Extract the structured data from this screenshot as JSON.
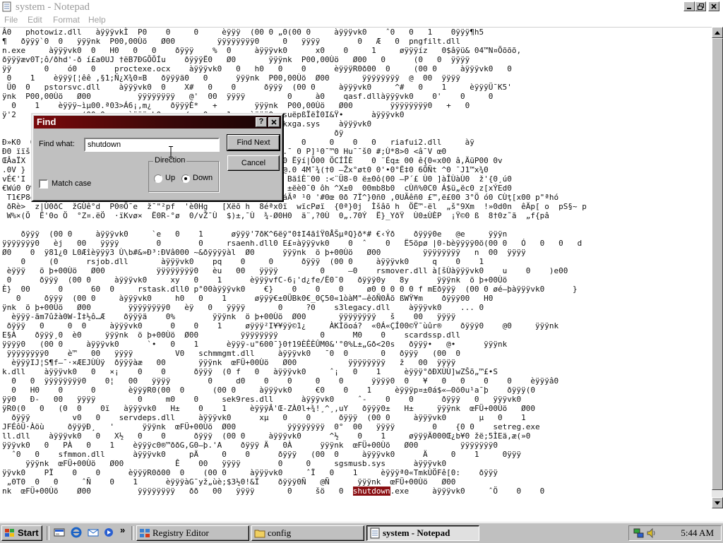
{
  "window": {
    "title": "system - Notepad",
    "menu": [
      "File",
      "Edit",
      "Format",
      "Help"
    ]
  },
  "editor": {
    "lines": [
      "Â0   photowiz.dll   àÿÿÿvkÌ  P0    0     0     èÿÿÿ  (00 0 „0(00 0     àÿÿÿvk0    ˆ0   0   1    0ÿÿÿ¶h5",
      "¶   ðÿÿÿ`0  0   ÿÿÿnk  P00,00Ùö   Ø00         ÿÿÿÿÿÿÿÿ0     0   ÿÿÿÿ        0   Æ   0  pngfilt.dll",
      "n.exe     àÿÿÿvk0  0   H0   0   0    ðÿÿÿ    %  0     àÿÿÿvk0      x0    0     1     øÿÿÿíz   0$âÿü& 04™N¤Õõõõ,",
      "ðÿÿÿæv0T;ô/ðhd'-ð í£a0UJ †ëB7ÐGÕÕÍu    ðÿÿÿË0   Ø0       ÿÿÿnk  P00,00Ùö   Ø00   0      (0   0  ÿÿÿÿ",
      "ÿÿ       0    ó0   0    proctexe.ocx    àÿÿÿvk0   0   h0   0    0      èÿÿÿR0ð00  0     (00 0     àÿÿÿvk0   0",
      " 0    1    èÿÿÿ[¦êê ,§1;Ñ¿X¾0¤B   ðÿÿÿä0   0      ÿÿÿnk  P00,00Ùö  Ø00       ÿÿÿÿÿÿÿÿ  @  00  ÿÿÿÿ",
      " Ü0  0   pstorsvc.dll    àÿÿÿvk0  0    X#   0    0      ðÿÿÿ  (00 0     àÿÿÿvk0     ^#   0    1     èÿÿÿÜ¯K5'",
      "ÿnk  P00,00Ùö   Ø00          ÿÿÿÿÿÿÿÿ   @'  00  ÿÿÿÿ         0     à0    qasf.dllàÿÿÿvk0    0'    0     0",
      "  0    1    èÿÿÿ~ìµ00.ª03>Á6¡,m¿    ðÿÿÿÈ*   +        ÿÿÿnk  P00,00Ùö   Ø00        ÿÿÿÿÿÿÿÿ0   +   0",
      "ÿ'2              (00 0     àÿÿÿvk0    x/   0    1    èÿÿÿ0•„suëpßÏëÌ0I&Ÿ•      àÿÿÿvk0",
      "        0                 03   ÿÿÿÿ           0         r2mdkxga.sys    àÿÿÿvk0",
      "        Kv§l'-Ê0ÊÂ     ðÿÿÿ6  (7       ÿÿÿnk  P00,00Ùö   Ø00           ðÿ",
      "Ð»K0  0  0                       ÿÿÿÿÿÿÿÿ0   >   00  ÿÿÿÿ       0     0    0   0   riafui2.dll     àÿ",
      "Ð0 ïïš                           ¬Ãşn0-0 Ù&ÏÂõ-0 #¾Ab0-0 ÿYÖ.¯ 0 P]¹0¯™0 Hu¯¯š0 #;Ù*8>0 <â¯V œ0",
      "ŒÂaÏX                           ^&°00 0¦`&´00 -0Ü0800 /0.g000 Ëÿí|Õ00 ÖCÍÎÈ    0 ¨Éq± 00 ê{0«x00 â,ÄüP00 0v",
      ".0V }                           x,0 Ï¾²n±0 P¤=0 A=-3h„0 ¨uüí@.0 4M¯¾(†0 –Žx°øt0 0'•0°Ë‡0 6ÕÑt ^0 ¯J1™x¾0",
      "vÉ€'I                          0Ð0Ò Ž00V ô0 2†£]¯õ0 ..2$ÿp00 BãîÈ¨00 :<¨Ü8-0 ë±0ô(00 –P´£ Ù0 ]àÎÙàÙ0  ž'{0¸ú0",
      "€Wú0 0%    ¢0                  +~°&0K0¯Š0 Ð|0 éÜÿª0 ž0-w¯¬_0 ±ëè0¯0 ôh ^X±0  00mb8b0  cÙñ%0C0 Á$ü„ëc0 z[xÝEd0",
      " T1€P8ë0 s0âõ0ê0 ½éÐšèè0 kŽÏwÄë0 »ë0>¨ï0 â   'fpì0 &Â(âH¹0 ÏáÃª ¹0 '#0œ 0ð 7Ï^}0ñ0 ,0UÃêñ0 £™,ë£00 3°Ö ó0 CÙţ[x00 p\"ªhó",
      " ðRè>  z|Ù0ðC  žGÙê°d  P0®Ö¯e  ž¯\"²pf  'è0Hg   [Xëõ h  8éªx0ï  wïcPøï  {0ª}0j  Ìšâõ h  ÖË™-ël  „š\"9Xm  !»0d0n  êÄp[ o  pS§~ p",
      " W%×(Ö  Ë'0o Ö  °Z¤.ëÖ  ·ïKvø×  Ë0R-°ø  0/vŽ¯Ù  $)±,¯Ù  ¾-Ø0H0  ä¨,?0Ù  0„.70Ý  Ë}_YðŸ  Ù0±ÙÈP  ¡Ÿ©0 ß  8†0z˜ã  „f{pâ",
      "",
      "    ðÿÿÿ  (00 0     àÿÿÿvk0     `e   0    1      øÿÿÿ'7ðK^6ëÿ\"0‡I4ãîŸ0ÅŠµªQ}ð*# €‹Ýð    ðÿÿÿ0e   @e     ÿÿÿn",
      "ÿÿÿÿÿÿÿ0   èj   00   ÿÿÿÿ        0        0     rsaenh.dll0 E£¤àÿÿÿvk0    0  ˆ    0   Ë5öpø |0-bèÿÿÿÿ0ö(00 0   Ó   0   0   d",
      "Ø0    0  ÿ81¿0 L0Æîèÿÿÿ3 Ù\\b#&»Ð³:ÐVâ000 ~&ðÿÿÿÿàl  Ø0      ÿÿÿnk  ö þ+00Ùö   Ø00         ÿÿÿÿÿÿÿÿ   n  00  ÿÿÿÿ",
      "    0     (0      rsjob.dll       àÿÿÿvk0    pq    0     0      ðÿÿÿ  (00 0     àÿÿÿvk0     q    0    1",
      " èÿÿÿ   ö þ+00Ùö   Ø00           ÿÿÿÿÿÿÿÿ0   èu   00   ÿÿÿÿ         0     –0    rsmover.dll à[šÙàÿÿÿvk0    u    0    )e00",
      " 0      ðÿÿÿ  (00 0     àÿÿÿvk0     xy   0    1      èÿÿÿvfC-6¡'d¿fe/Ë0¯0   ðÿÿÿ0y   8y      ÿÿÿnk  ö þ+00Ùö  ",
      "È}  00      0      60  0     rstask.dll0 p°00àÿÿÿvk0    €}    0    0    0     ø0 0 0 0 0 f mEðÿÿÿ  (00 0 øé–þàÿÿÿvk0      }",
      "   0     ðÿÿÿ  (00 0     àÿÿÿvk0     h0   0    1      øÿÿÿ€±0ÜBk0€_0Ç50«1òàM\"–êõÑ0Âõ ßWŸ¥m    ðÿÿÿ00   H0",
      "ÿnk  ö þ+00Ùö   Ø00        ÿÿÿÿÿÿÿÿ0   èÿ   0   ÿÿÿÿ       0     ?0    s3legacy.dll    àÿÿÿvk0    ... 0",
      "  èÿÿÿ-ãm7ûžà0W-Ì‡½ô…Æ    ðÿÿÿä    0%        ÿÿÿnk  ö þ+00Ùö  Ø00       ÿÿÿÿÿÿÿÿ   š    00   ÿÿÿÿ",
      " ðÿÿÿ   0     0  0     àÿÿÿvk0      0    0    1     øÿÿÿ²I¥¥ÿÿ©1¿     ÀKÌöoá?  «0Á«ÇÍ00©Ÿ¯ùûr®    ðÿÿÿ0    @0     ÿÿÿnk",
      "E§À    ðÿÿÿ¸0  è0     ÿÿÿnk  ö þ+00Ùö  Ø00         ÿÿÿÿÿÿÿÿ         0      M0    0    scardssp.dll",
      "ÿÿÿÿ0   (00 0     àÿÿÿvk0      `•   0    1      èÿÿÿ-u\"600¯}0†19ÈÊÈÛM0&'°0%L±„Gð<20s   ðÿÿÿ•   @•      ÿÿÿnk",
      " ÿÿÿÿÿÿÿÿ0    è™   00   ÿÿÿÿ         V0   schmmgmt.dll     àÿÿÿvk0   ¯0  0       0   ðÿÿÿ   (00  0",
      "  èÿÿÿIJ¦S¶f–¯·×ÆEJÙÙÿ  ðÿÿÿàæ   00       ÿÿÿnk  œFÜ+00Ùö   Ø00           ÿÿÿÿÿÿÿÿ   ž   00  ÿÿÿÿ",
      "k.dll    àÿÿÿvk0   0   ×¡    0    0      ðÿÿÿ  (0 f   0   àÿÿÿvk0     ˆ¡   0    1     èÿÿÿ°ðÐXÙÙ]wZŠõ„™£•S",
      "  0   0  ÿÿÿÿÿÿÿÿ0    0¦   00   ÿÿÿÿ        0     d0    0    0     0    0      ÿÿÿÿ0  0   ¥   0   0    0    0    èÿÿÿâ0",
      "  0   H0    0      0       èÿÿÿR0(00  0      (00 0     àÿÿÿvk0     €0    0    1     èÿÿÿp¤±0á$«–0ö0u¹a¯þ    ðÿÿÿ(0",
      "ÿÿ0   Ð-   00   ÿÿÿÿ         0     m0    0     sek9res.dll      àÿÿÿvk0     ˆ-    0    0      ðÿÿÿ   0   ÿÿÿvk0",
      "ÿR0(0   0   (0  0    0ï   àÿÿÿvk0   H±    0    1     èÿÿÿÂ'Œ-ZÀ0l+¾!¸^¸,uY   ðÿÿÿ0±   H±     ÿÿÿnk  œFÜ+00Ùö   Ø00",
      "  ðÿÿÿ         v0   0    servdeps.dll     àÿÿÿvk0      xµ   0    0      ðÿÿÿ  (00 0     àÿÿÿvk0       µ   0    1",
      "JFÉôÜ·Àöù     ðÿÿÿÐ¸   '      ÿÿÿnk  œFÜ+00Ùö  Ø00           ÿÿÿÿÿÿÿÿ  0°  00   ÿÿÿÿ        0    {0 0    setreg.exe",
      "ll.dll    àÿÿÿvk0   0   X½   0    0      ðÿÿÿ  (00 0     àÿÿÿvk0      ^½    0    1     øÿÿÿÄ000Œ¿b¥0 žë;5ÌEä,æ(»0",
      "ÿÿÿvk0   0   PÀ   0    1    èÿÿÿc0®™ððG,G0–þ.'A    ðÿÿÿ Ä   0À      ÿÿÿnk  œFÜ+00Ùö   Ø00         ÿÿÿÿÿÿÿ0",
      "  ˆ0   0    sfmmon.dll      àÿÿÿvk0     pÄ     0    0      ðÿÿÿ   (00  0     àÿÿÿvk0      Ä     0    1     0ÿÿÿ",
      "     ÿÿÿnk  œFÜ+00Ùö   Ø00           Ê    00   ÿÿÿÿ        0     0     sgsmusb.sys      àÿÿÿvk0",
      "ÿÿvk0    PÏ    0    0      èÿÿÿR0ð00  0    (00 0     àÿÿÿvk0     ˆÏ   0    1     èÿÿÿª0«TmkÙÖFê[0:    ðÿÿÿ",
      " „0T0  0   0     ˆÑ    0    1      èÿÿÿàG¯yž„ùè;$3½0!&Ï    ðÿÿÿ0Ñ   @Ñ      ÿÿÿnk  œFÜ+00Ùö   Ø00",
      {
        "pre": "nk  œFÜ+00Ùö    Ø00          ÿÿÿÿÿÿÿÿ   ðð   00   ÿÿÿÿ       0     šö   0  ",
        "hl": "shutdown",
        "post": ".exe     àÿÿÿvk0     ˆÖ    0    0"
      }
    ]
  },
  "find_dialog": {
    "title": "Find",
    "find_what_label": "Find what:",
    "find_what_value": "shutdown",
    "find_next_label": "Find Next",
    "cancel_label": "Cancel",
    "direction_label": "Direction",
    "up_label": "Up",
    "down_label": "Down",
    "direction_selected": "Down",
    "match_case_label": "Match case",
    "match_case_checked": false
  },
  "taskbar": {
    "start_label": "Start",
    "tasks": [
      {
        "label": "Registry Editor",
        "icon": "registry-editor-icon",
        "active": false
      },
      {
        "label": "config",
        "icon": "folder-icon",
        "active": false
      },
      {
        "label": "system - Notepad",
        "icon": "notepad-icon",
        "active": true
      }
    ],
    "clock": "5:44 AM"
  }
}
